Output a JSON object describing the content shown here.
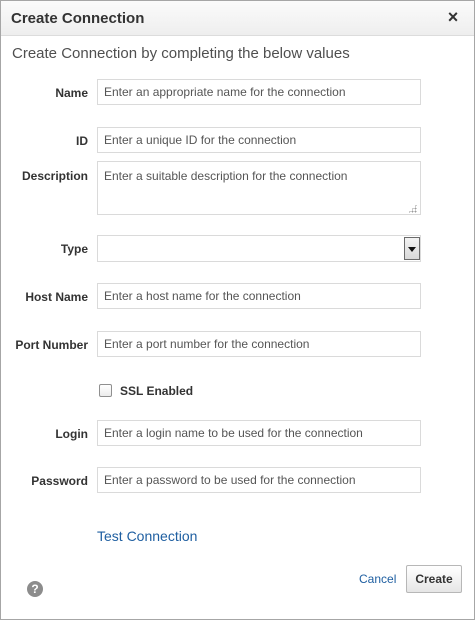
{
  "dialog": {
    "title": "Create Connection",
    "close_glyph": "×",
    "subtitle": "Create Connection by completing the below values"
  },
  "fields": {
    "name": {
      "label": "Name",
      "placeholder": "Enter an appropriate name for the connection",
      "value": ""
    },
    "id": {
      "label": "ID",
      "placeholder": "Enter a unique ID for the connection",
      "value": ""
    },
    "description": {
      "label": "Description",
      "placeholder": "Enter a suitable description for the connection",
      "value": ""
    },
    "type": {
      "label": "Type",
      "value": ""
    },
    "host_name": {
      "label": "Host Name",
      "placeholder": "Enter a host name for the connection",
      "value": ""
    },
    "port_number": {
      "label": "Port Number",
      "placeholder": "Enter a port number for the connection",
      "value": ""
    },
    "ssl": {
      "label": "SSL Enabled",
      "checked": false
    },
    "login": {
      "label": "Login",
      "placeholder": "Enter a login name to be used for the connection",
      "value": ""
    },
    "password": {
      "label": "Password",
      "placeholder": "Enter a password to be used for the connection",
      "value": ""
    }
  },
  "actions": {
    "test_connection": "Test Connection",
    "cancel": "Cancel",
    "create": "Create",
    "help_glyph": "?"
  },
  "icons": {
    "close": "close-icon",
    "help": "help-icon",
    "dropdown": "chevron-down-icon",
    "resize": "resize-grip-icon"
  },
  "colors": {
    "link": "#1f5fa1",
    "label": "#333333",
    "field_border": "#dadada"
  }
}
